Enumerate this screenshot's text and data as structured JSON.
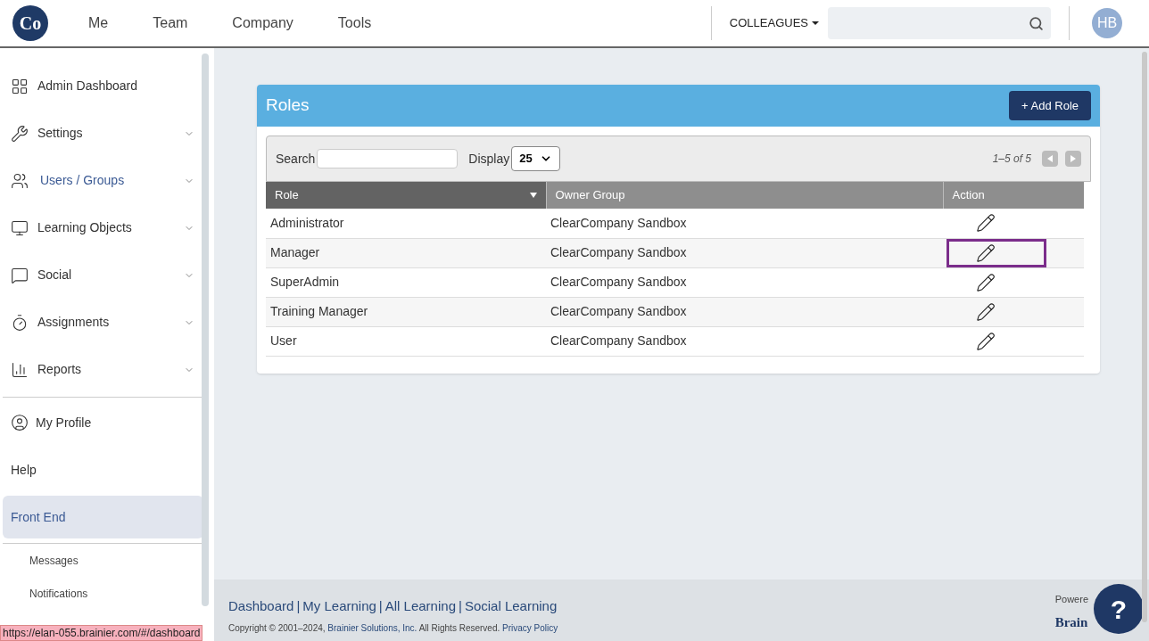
{
  "header": {
    "logo": "Co",
    "nav": [
      "Me",
      "Team",
      "Company",
      "Tools"
    ],
    "scope_menu": "COLLEAGUES",
    "avatar": "HB"
  },
  "sidebar": {
    "items": [
      {
        "label": "Admin Dashboard",
        "kind": "grid",
        "expandable": false,
        "accent": false,
        "selected": false
      },
      {
        "label": "Settings",
        "kind": "tools",
        "expandable": true,
        "accent": false,
        "selected": false
      },
      {
        "label": "Users / Groups",
        "kind": "users",
        "expandable": true,
        "accent": true,
        "selected": false
      },
      {
        "label": "Learning Objects",
        "kind": "monitor",
        "expandable": true,
        "accent": false,
        "selected": false
      },
      {
        "label": "Social",
        "kind": "chat",
        "expandable": true,
        "accent": false,
        "selected": false
      },
      {
        "label": "Assignments",
        "kind": "timer",
        "expandable": true,
        "accent": false,
        "selected": false
      },
      {
        "label": "Reports",
        "kind": "chart",
        "expandable": true,
        "accent": false,
        "selected": false
      }
    ],
    "lower_items": [
      {
        "label": "My Profile",
        "kind": "profile",
        "accent": false,
        "selected": false
      },
      {
        "label": "Help",
        "kind": "plain",
        "accent": false,
        "selected": false
      },
      {
        "label": "Front End",
        "kind": "plain",
        "accent": true,
        "selected": true
      }
    ],
    "sub_items": [
      "Messages",
      "Notifications"
    ]
  },
  "roles_card": {
    "title": "Roles",
    "add_button": "+ Add Role",
    "search_label": "Search",
    "display_label": "Display",
    "display_value": "25",
    "pagination": "1–5 of 5",
    "columns": [
      {
        "label": "Role",
        "sorted": true
      },
      {
        "label": "Owner Group",
        "sorted": false
      },
      {
        "label": "Action",
        "sorted": false
      }
    ],
    "rows": [
      {
        "role": "Administrator",
        "owner_group": "ClearCompany Sandbox",
        "highlighted": false
      },
      {
        "role": "Manager",
        "owner_group": "ClearCompany Sandbox",
        "highlighted": true
      },
      {
        "role": "SuperAdmin",
        "owner_group": "ClearCompany Sandbox",
        "highlighted": false
      },
      {
        "role": "Training Manager",
        "owner_group": "ClearCompany Sandbox",
        "highlighted": false
      },
      {
        "role": "User",
        "owner_group": "ClearCompany Sandbox",
        "highlighted": false
      }
    ]
  },
  "footer": {
    "links": [
      "Dashboard",
      "My Learning",
      "All Learning",
      "Social Learning"
    ],
    "separator": "|",
    "copyright": "Copyright © 2001–2024,",
    "company_link": "Brainier Solutions, Inc.",
    "rights": "All Rights Reserved.",
    "privacy_link": "Privacy Policy",
    "powered": "Powere",
    "brand": "Brain",
    "help_button": "?"
  },
  "status_url": "https://elan-055.brainier.com/#/dashboard"
}
